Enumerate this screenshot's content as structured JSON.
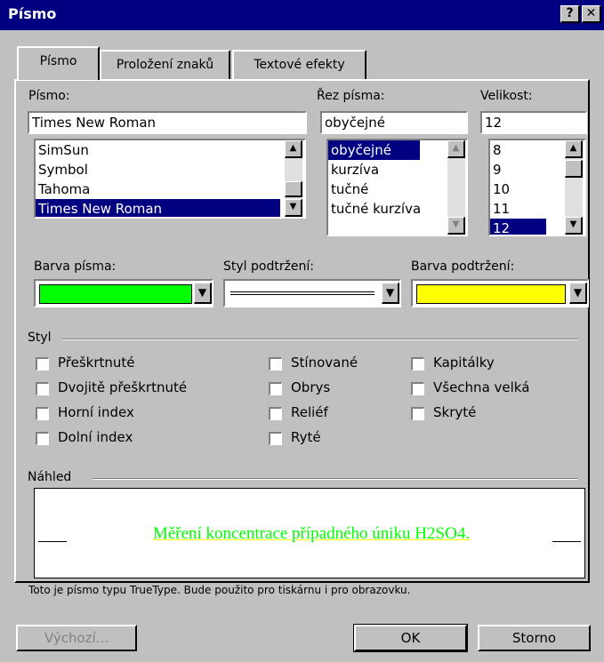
{
  "window": {
    "title": "Písmo",
    "help": "?",
    "close": "✕"
  },
  "tabs": [
    "Písmo",
    "Proložení znaků",
    "Textové efekty"
  ],
  "font": {
    "label": "Písmo:",
    "value": "Times New Roman",
    "items": [
      "SimSun",
      "Symbol",
      "Tahoma",
      "Times New Roman"
    ],
    "selected": "Times New Roman"
  },
  "style": {
    "label": "Řez písma:",
    "value": "obyčejné",
    "items": [
      "obyčejné",
      "kurzíva",
      "tučné",
      "tučné kurzíva"
    ],
    "selected": "obyčejné"
  },
  "size": {
    "label": "Velikost:",
    "value": "12",
    "items": [
      "8",
      "9",
      "10",
      "11",
      "12"
    ],
    "selected": "12"
  },
  "font_color": {
    "label": "Barva písma:",
    "color": "#00ff00"
  },
  "underline_style": {
    "label": "Styl podtržení:"
  },
  "underline_color": {
    "label": "Barva podtržení:",
    "color": "#ffff00"
  },
  "effects": {
    "label": "Styl",
    "col1": [
      "Přeškrtnuté",
      "Dvojitě přeškrtnuté",
      "Horní index",
      "Dolní index"
    ],
    "col2": [
      "Stínované",
      "Obrys",
      "Reliéf",
      "Ryté"
    ],
    "col3": [
      "Kapitálky",
      "Všechna velká",
      "Skryté"
    ]
  },
  "preview": {
    "label": "Náhled",
    "text": "Měření koncentrace případného úniku H2SO4.",
    "text_color": "#00ff00",
    "underline_color": "#ffff00",
    "note": "Toto je písmo typu TrueType. Bude použito pro tiskárnu i pro obrazovku."
  },
  "buttons": {
    "default": "Výchozí...",
    "ok": "OK",
    "cancel": "Storno"
  },
  "icons": {
    "up": "scroll-up-icon",
    "down": "scroll-down-icon",
    "dropdown": "chevron-down-icon"
  }
}
